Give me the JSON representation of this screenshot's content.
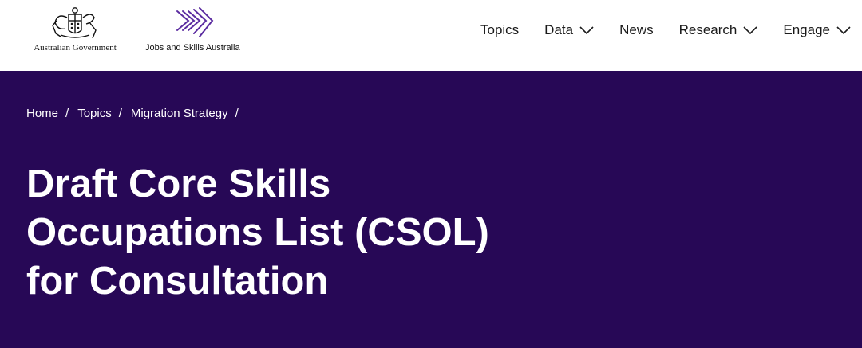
{
  "header": {
    "gov_logo_text": "Australian Government",
    "agency_logo_text": "Jobs and Skills Australia",
    "nav": [
      {
        "label": "Topics",
        "has_dropdown": false
      },
      {
        "label": "Data",
        "has_dropdown": true
      },
      {
        "label": "News",
        "has_dropdown": false
      },
      {
        "label": "Research",
        "has_dropdown": true
      },
      {
        "label": "Engage",
        "has_dropdown": true
      }
    ]
  },
  "breadcrumb": {
    "items": [
      "Home",
      "Topics",
      "Migration Strategy"
    ],
    "separator": "/"
  },
  "hero": {
    "title_lines": [
      "Draft Core Skills",
      "Occupations List (CSOL)",
      "for Consultation"
    ]
  },
  "colors": {
    "hero_bg": "#270856",
    "accent_purple": "#5b2ca0",
    "header_bg": "#ffffff"
  },
  "icons": {
    "gov_logo": "coat-of-arms-icon",
    "agency_logo": "chevron-arrows-icon",
    "dropdown": "chevron-down-icon"
  }
}
